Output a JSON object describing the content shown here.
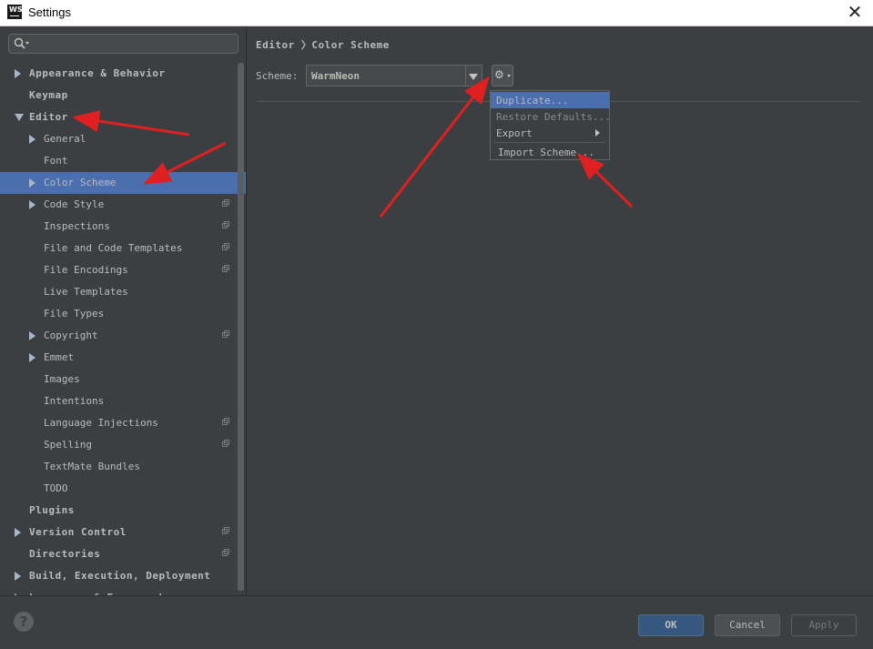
{
  "window": {
    "title": "Settings",
    "logo_text": "WS"
  },
  "search": {
    "placeholder": ""
  },
  "tree": [
    {
      "label": "Appearance & Behavior",
      "bold": true,
      "arrow": "right",
      "indent": 0
    },
    {
      "label": "Keymap",
      "bold": true,
      "arrow": "",
      "indent": 0
    },
    {
      "label": "Editor",
      "bold": true,
      "arrow": "down",
      "indent": 0
    },
    {
      "label": "General",
      "bold": false,
      "arrow": "right",
      "indent": 1
    },
    {
      "label": "Font",
      "bold": false,
      "arrow": "",
      "indent": 1
    },
    {
      "label": "Color Scheme",
      "bold": false,
      "arrow": "right",
      "indent": 1,
      "selected": true
    },
    {
      "label": "Code Style",
      "bold": false,
      "arrow": "right",
      "indent": 1,
      "project": true
    },
    {
      "label": "Inspections",
      "bold": false,
      "arrow": "",
      "indent": 1,
      "project": true
    },
    {
      "label": "File and Code Templates",
      "bold": false,
      "arrow": "",
      "indent": 1,
      "project": true
    },
    {
      "label": "File Encodings",
      "bold": false,
      "arrow": "",
      "indent": 1,
      "project": true
    },
    {
      "label": "Live Templates",
      "bold": false,
      "arrow": "",
      "indent": 1
    },
    {
      "label": "File Types",
      "bold": false,
      "arrow": "",
      "indent": 1
    },
    {
      "label": "Copyright",
      "bold": false,
      "arrow": "right",
      "indent": 1,
      "project": true
    },
    {
      "label": "Emmet",
      "bold": false,
      "arrow": "right",
      "indent": 1
    },
    {
      "label": "Images",
      "bold": false,
      "arrow": "",
      "indent": 1
    },
    {
      "label": "Intentions",
      "bold": false,
      "arrow": "",
      "indent": 1
    },
    {
      "label": "Language Injections",
      "bold": false,
      "arrow": "",
      "indent": 1,
      "project": true
    },
    {
      "label": "Spelling",
      "bold": false,
      "arrow": "",
      "indent": 1,
      "project": true
    },
    {
      "label": "TextMate Bundles",
      "bold": false,
      "arrow": "",
      "indent": 1
    },
    {
      "label": "TODO",
      "bold": false,
      "arrow": "",
      "indent": 1
    },
    {
      "label": "Plugins",
      "bold": true,
      "arrow": "",
      "indent": 0
    },
    {
      "label": "Version Control",
      "bold": true,
      "arrow": "right",
      "indent": 0,
      "project": true
    },
    {
      "label": "Directories",
      "bold": true,
      "arrow": "",
      "indent": 0,
      "project": true
    },
    {
      "label": "Build, Execution, Deployment",
      "bold": true,
      "arrow": "right",
      "indent": 0
    },
    {
      "label": "Languages & Frameworks",
      "bold": true,
      "arrow": "right",
      "indent": 0
    }
  ],
  "breadcrumb": "Editor 〉Color Scheme",
  "scheme": {
    "label": "Scheme:",
    "value": "WarmNeon"
  },
  "gear_glyph": "⚙",
  "menu": [
    {
      "label": "Duplicate...",
      "selected": true
    },
    {
      "label": "Restore Defaults...",
      "disabled": true
    },
    {
      "label": "Export",
      "submenu": true
    },
    {
      "label": "Import Scheme..."
    }
  ],
  "buttons": {
    "help": "?",
    "ok": "OK",
    "cancel": "Cancel",
    "apply": "Apply"
  },
  "colors": {
    "selection": "#4b6eaf",
    "background": "#3c3f41",
    "annotation_arrow": "#e02020"
  }
}
